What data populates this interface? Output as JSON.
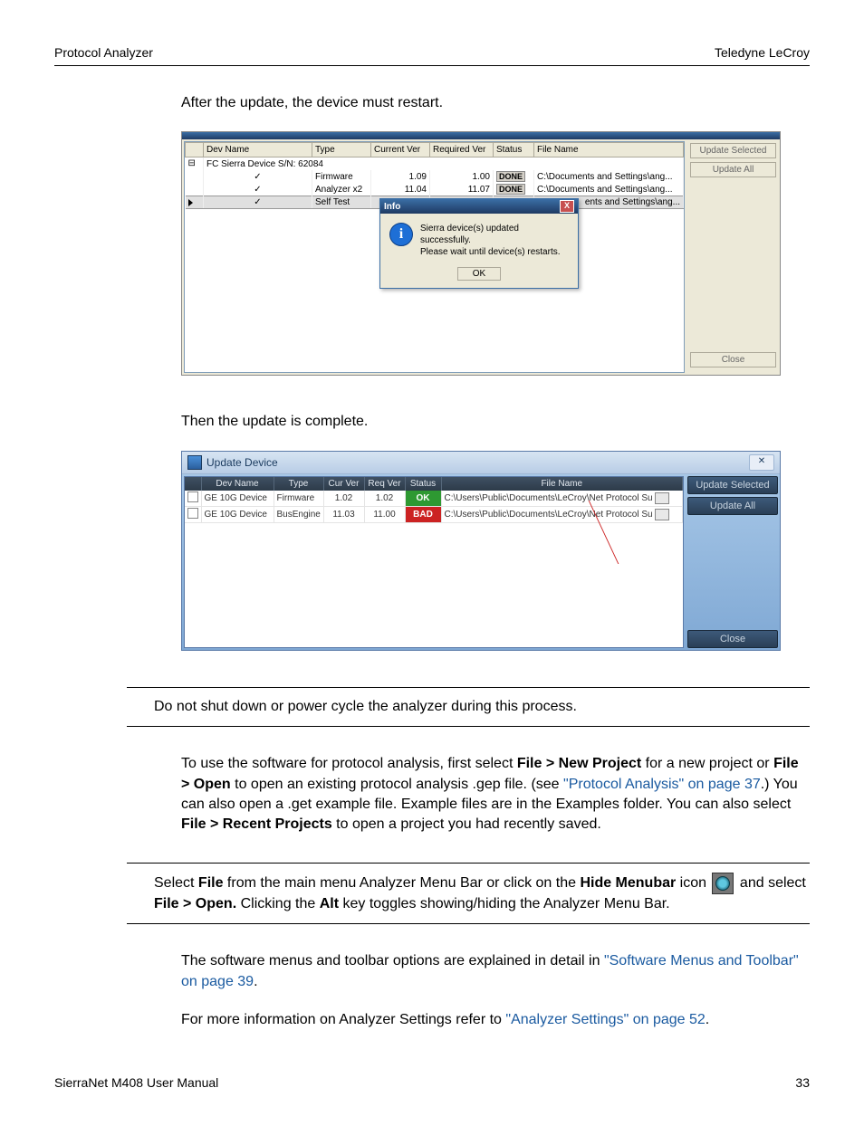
{
  "header": {
    "left": "Protocol Analyzer",
    "right": "Teledyne LeCroy"
  },
  "para1": "After the update, the device must restart.",
  "shot1": {
    "headers": {
      "dev": "Dev Name",
      "type": "Type",
      "curr": "Current Ver",
      "req": "Required Ver",
      "status": "Status",
      "file": "File Name"
    },
    "tree_root": "FC Sierra Device S/N: 62084",
    "rows": [
      {
        "chk": "✓",
        "type": "Firmware",
        "curr": "1.09",
        "req": "1.00",
        "status": "DONE",
        "file": "C:\\Documents and Settings\\ang..."
      },
      {
        "chk": "✓",
        "type": "Analyzer x2",
        "curr": "11.04",
        "req": "11.07",
        "status": "DONE",
        "file": "C:\\Documents and Settings\\ang..."
      },
      {
        "chk": "✓",
        "type": "Self Test",
        "curr": "",
        "req": "",
        "status": "",
        "file": "ents and Settings\\ang..."
      }
    ],
    "side": {
      "update_selected": "Update Selected",
      "update_all": "Update All",
      "close": "Close"
    },
    "dialog": {
      "title": "Info",
      "msg1": "Sierra device(s) updated successfully.",
      "msg2": "Please wait until device(s) restarts.",
      "ok": "OK"
    }
  },
  "para2": "Then the update is complete.",
  "shot2": {
    "title": "Update Device",
    "headers": {
      "blank": "",
      "dev": "Dev Name",
      "type": "Type",
      "cur": "Cur Ver",
      "req": "Req Ver",
      "status": "Status",
      "file": "File Name"
    },
    "rows": [
      {
        "dev": "GE 10G Device",
        "type": "Firmware",
        "cur": "1.02",
        "req": "1.02",
        "status": "OK",
        "file": "C:\\Users\\Public\\Documents\\LeCroy\\Net Protocol Su"
      },
      {
        "dev": "GE 10G Device",
        "type": "BusEngine",
        "cur": "11.03",
        "req": "11.00",
        "status": "BAD",
        "file": "C:\\Users\\Public\\Documents\\LeCroy\\Net Protocol Su"
      }
    ],
    "side": {
      "update_selected": "Update Selected",
      "update_all": "Update All",
      "close": "Close"
    }
  },
  "note1": "Do not shut down or power cycle the analyzer during this process.",
  "para3": {
    "t1": "To use the software for protocol analysis, first select ",
    "b1": "File > New Project",
    "t2": " for a new project or ",
    "b2": "File > Open",
    "t3": " to open an existing protocol analysis .gep file. (see ",
    "l1": "\"Protocol Analysis\" on page 37",
    "t4": ".) You can also open a .get example file. Example files are in the Examples folder. You can also select ",
    "b3": "File > Recent Projects",
    "t5": " to open a project you had recently saved."
  },
  "note2": {
    "t1": "Select ",
    "b1": "File",
    "t2": " from the main menu Analyzer Menu Bar or click on the ",
    "b2": "Hide Menubar",
    "t3": " icon ",
    "t4": " and select ",
    "b3": "File > Open.",
    "t5": " Clicking the ",
    "b4": "Alt",
    "t6": " key toggles showing/hiding the Analyzer Menu Bar."
  },
  "para4": {
    "t1": "The software menus and toolbar options are explained in detail in ",
    "l1": "\"Software Menus and Toolbar\" on page 39",
    "t2": "."
  },
  "para5": {
    "t1": "For more information on Analyzer Settings refer to ",
    "l1": "\"Analyzer Settings\" on page 52",
    "t2": "."
  },
  "footer": {
    "left": "SierraNet M408 User Manual",
    "right": "33"
  }
}
